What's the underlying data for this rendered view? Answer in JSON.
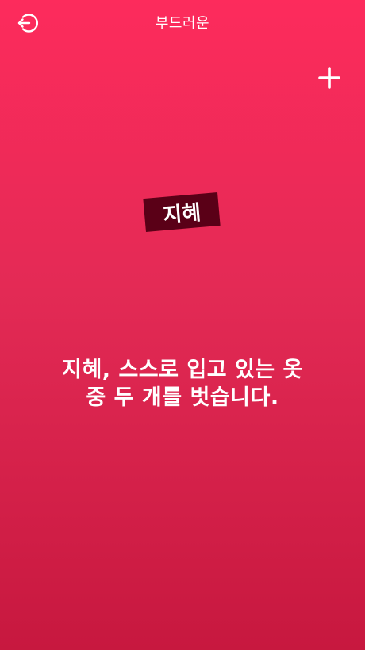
{
  "header": {
    "title": "부드러운",
    "back_icon": "logout-arrow-icon",
    "add_icon": "plus-icon"
  },
  "card": {
    "player_name": "지혜",
    "dare_text": "지혜, 스스로 입고 있는 옷\n중 두 개를 벗습니다."
  },
  "colors": {
    "background_top": "#fd2b5c",
    "background_bottom": "#c7183f",
    "name_tag": "#5a0017",
    "text": "#ffffff"
  }
}
